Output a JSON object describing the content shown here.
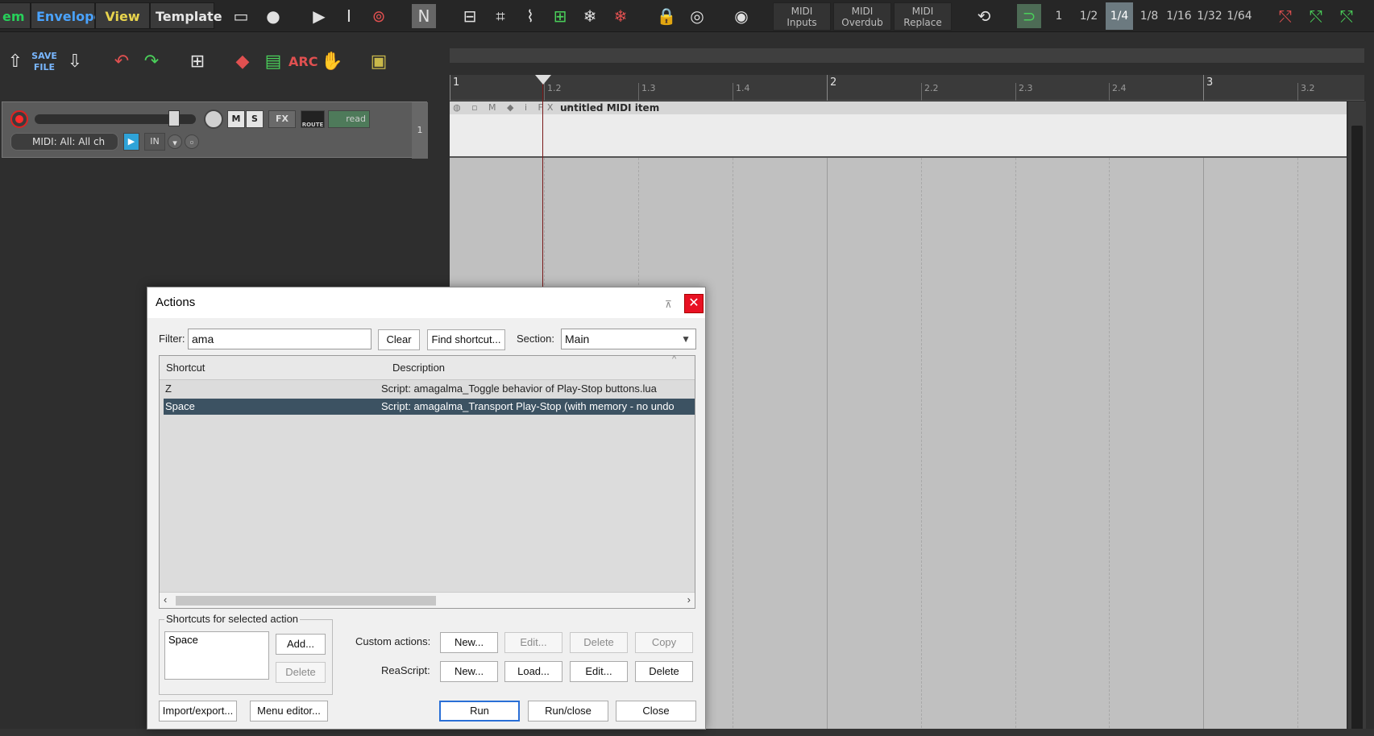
{
  "menubar": {
    "menus": [
      {
        "label": "em",
        "color": "#27d05a"
      },
      {
        "label": "Envelope",
        "color": "#4aa3ff"
      },
      {
        "label": "View",
        "color": "#e8d44d"
      },
      {
        "label": "Template",
        "color": "#e6e6e6"
      }
    ],
    "midi_buttons": [
      {
        "line1": "MIDI",
        "line2": "Inputs"
      },
      {
        "line1": "MIDI",
        "line2": "Overdub"
      },
      {
        "line1": "MIDI",
        "line2": "Replace"
      }
    ],
    "grid_values": [
      "1",
      "1/2",
      "1/4",
      "1/8",
      "1/16",
      "1/32",
      "1/64"
    ],
    "grid_selected": "1/4"
  },
  "toolbar2": {
    "save_line1": "SAVE",
    "save_line2": "FILE"
  },
  "ruler": {
    "labels": [
      {
        "text": "1",
        "kind": "major"
      },
      {
        "text": "1.2",
        "kind": "minor"
      },
      {
        "text": "1.3",
        "kind": "minor"
      },
      {
        "text": "1.4",
        "kind": "minor"
      },
      {
        "text": "2",
        "kind": "major"
      },
      {
        "text": "2.2",
        "kind": "minor"
      },
      {
        "text": "2.3",
        "kind": "minor"
      },
      {
        "text": "2.4",
        "kind": "minor"
      },
      {
        "text": "3",
        "kind": "major"
      },
      {
        "text": "3.2",
        "kind": "minor"
      }
    ]
  },
  "track": {
    "item_name": "untitled MIDI item",
    "midi_input": "MIDI: All: All ch",
    "in_label": "IN",
    "mute_label": "M",
    "solo_label": "S",
    "fx_label": "FX",
    "route_label": "ROUTE",
    "automation_mode": "read",
    "track_number": "1"
  },
  "dialog": {
    "title": "Actions",
    "filter_label": "Filter:",
    "filter_value": "ama",
    "clear_label": "Clear",
    "find_shortcut_label": "Find shortcut...",
    "section_label": "Section:",
    "section_value": "Main",
    "columns": {
      "shortcut": "Shortcut",
      "description": "Description"
    },
    "rows": [
      {
        "shortcut": "Z",
        "description": "Script: amagalma_Toggle behavior of Play-Stop buttons.lua",
        "selected": false
      },
      {
        "shortcut": "Space",
        "description": "Script: amagalma_Transport Play-Stop (with memory - no undo",
        "selected": true
      }
    ],
    "shortcuts_group_label": "Shortcuts for selected action",
    "selected_shortcut": "Space",
    "add_label": "Add...",
    "delete_label": "Delete",
    "custom_actions_label": "Custom actions:",
    "custom_new": "New...",
    "custom_edit": "Edit...",
    "custom_delete": "Delete",
    "custom_copy": "Copy",
    "reascript_label": "ReaScript:",
    "reascript_new": "New...",
    "reascript_load": "Load...",
    "reascript_edit": "Edit...",
    "reascript_delete": "Delete",
    "import_export_label": "Import/export...",
    "menu_editor_label": "Menu editor...",
    "run_label": "Run",
    "run_close_label": "Run/close",
    "close_label": "Close"
  }
}
